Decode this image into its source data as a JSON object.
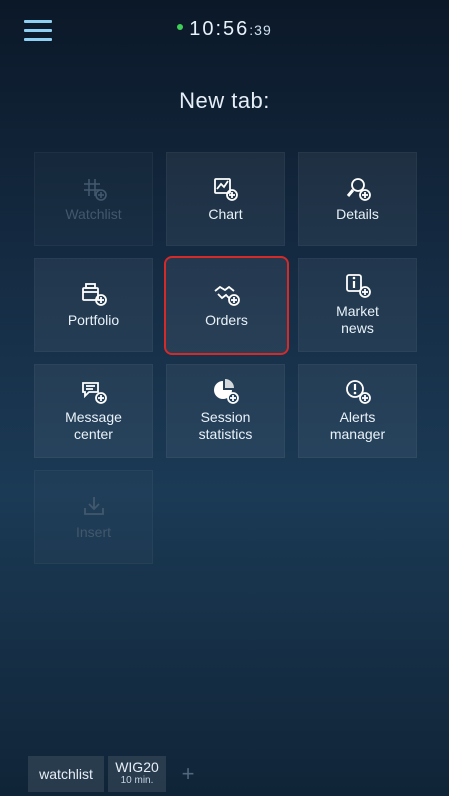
{
  "status": {
    "time_main": "10:56",
    "time_seconds": ":39",
    "connection_color": "#3fcf57"
  },
  "header": {
    "menu_icon": "hamburger-menu-icon",
    "title": "New tab:"
  },
  "tiles": [
    {
      "label": "Watchlist",
      "icon": "watchlist-add-icon",
      "enabled": false
    },
    {
      "label": "Chart",
      "icon": "chart-add-icon",
      "enabled": true
    },
    {
      "label": "Details",
      "icon": "details-search-add-icon",
      "enabled": true
    },
    {
      "label": "Portfolio",
      "icon": "portfolio-wallet-add-icon",
      "enabled": true
    },
    {
      "label": "Orders",
      "icon": "orders-handshake-add-icon",
      "enabled": true,
      "selected": true
    },
    {
      "label": "Market\nnews",
      "icon": "market-news-info-add-icon",
      "enabled": true
    },
    {
      "label": "Message\ncenter",
      "icon": "message-bubble-add-icon",
      "enabled": true
    },
    {
      "label": "Session\nstatistics",
      "icon": "session-statistics-pie-add-icon",
      "enabled": true
    },
    {
      "label": "Alerts\nmanager",
      "icon": "alert-add-icon",
      "enabled": true
    },
    {
      "label": "Insert",
      "icon": "insert-download-icon",
      "enabled": false
    }
  ],
  "bottom_tabs": {
    "watchlist": "watchlist",
    "wig_title": "WIG20",
    "wig_sub": "10 min.",
    "add": "+"
  },
  "colors": {
    "selection_border": "#d32a2a",
    "menu_icon": "#8fd0f2"
  }
}
